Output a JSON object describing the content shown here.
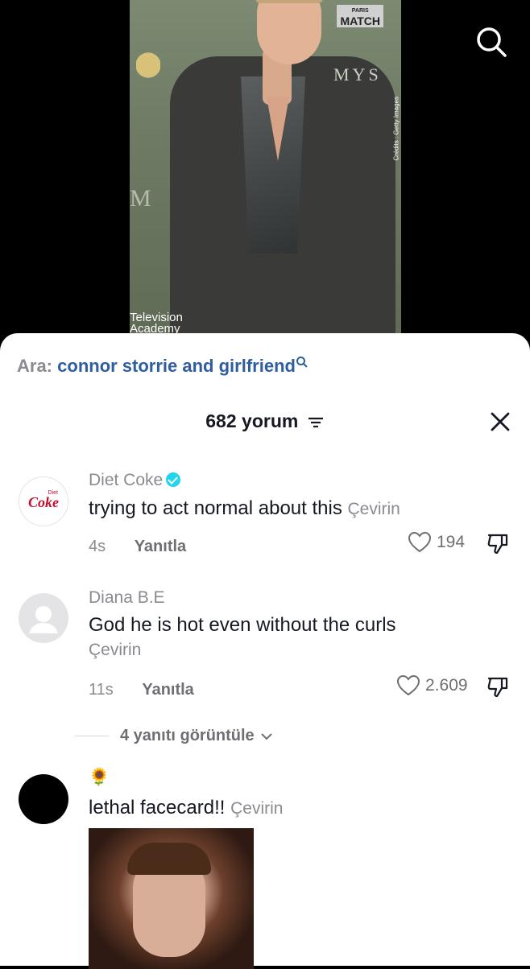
{
  "video": {
    "photo_brand": "MATCH",
    "photo_brand_small": "PARIS",
    "photo_credits": "Crédits : Getty Images",
    "photo_background_text": "MYS",
    "photo_background_text2": "M",
    "photo_caption_line1": "Television",
    "photo_caption_line2": "Academy"
  },
  "sheet": {
    "search_prefix": "Ara:",
    "search_query": "connor storrie and girlfriend",
    "comment_count_label": "682 yorum"
  },
  "comments": [
    {
      "avatar_text": "Coke",
      "avatar_text_small": "Diet",
      "username": "Diet Coke",
      "verified": true,
      "text": "trying to act normal about this",
      "translate": "Çevirin",
      "time": "4s",
      "reply": "Yanıtla",
      "likes": "194"
    },
    {
      "username": "Diana B.E",
      "text": "God he is hot even without the curls",
      "translate": "Çevirin",
      "time": "11s",
      "reply": "Yanıtla",
      "likes": "2.609",
      "view_replies": "4 yanıtı görüntüle"
    },
    {
      "username": "🌻",
      "text": "lethal facecard!!",
      "translate": "Çevirin"
    }
  ],
  "colors": {
    "accent_blue": "#2f5d9e",
    "verified": "#20d5ec",
    "muted": "#8a8b91"
  }
}
